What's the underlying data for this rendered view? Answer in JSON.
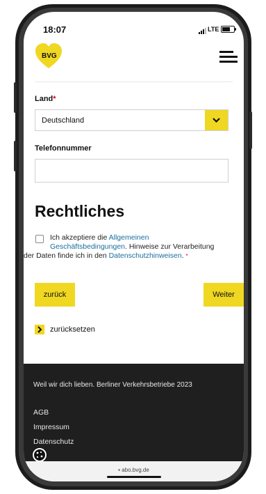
{
  "status": {
    "time": "18:07",
    "network": "LTE"
  },
  "header": {
    "logo_text": "BVG",
    "brand_color": "#f0d722"
  },
  "form": {
    "country_label": "Land",
    "required_mark": "*",
    "country_value": "Deutschland",
    "phone_label": "Telefonnummer",
    "phone_value": ""
  },
  "legal": {
    "heading": "Rechtliches",
    "consent_part1": "Ich akzeptiere die ",
    "consent_link1a": "Allgemeinen",
    "consent_link1b": "Geschäftsbedingungen",
    "consent_part2": ". Hinweise zur Verarbeitung",
    "consent_part3": "der Daten finde ich in den ",
    "consent_link2": "Datenschutzhinweisen",
    "consent_part4": ".",
    "required_mark": "*",
    "link_color": "#1a6e9c"
  },
  "actions": {
    "back_label": "zurück",
    "next_label": "Weiter",
    "reset_label": "zurücksetzen"
  },
  "footer": {
    "tagline": "Weil wir dich lieben. Berliner Verkehrsbetriebe 2023",
    "links": [
      "AGB",
      "Impressum",
      "Datenschutz"
    ]
  },
  "browser": {
    "url": "abo.bvg.de"
  }
}
